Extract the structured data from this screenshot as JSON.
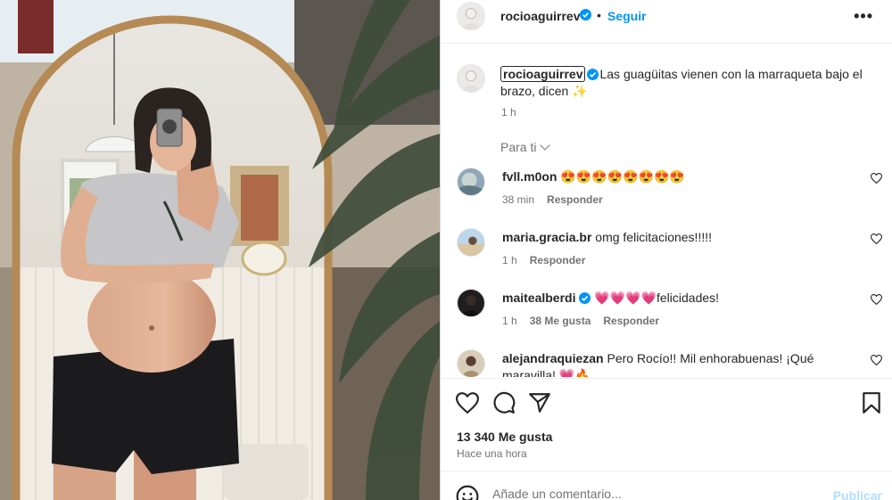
{
  "post": {
    "author": "rocioaguirrev",
    "verified_icon": "verified-badge-icon",
    "separator": "•",
    "follow_label": "Seguir",
    "more_icon": "more-options-icon",
    "more_label": "•••",
    "caption_text": "Las guagüitas vienen con la marraqueta bajo el brazo, dicen",
    "caption_emoji": "✨",
    "caption_time": "1 h",
    "for_you_label": "Para ti"
  },
  "comments": [
    {
      "username": "fvll.m0on",
      "verified": false,
      "text": "😍😍😍😍😍😍😍😍",
      "time": "38 min",
      "likes": "",
      "reply": "Responder"
    },
    {
      "username": "maria.gracia.br",
      "verified": false,
      "text": "omg felicitaciones!!!!!",
      "time": "1 h",
      "likes": "",
      "reply": "Responder"
    },
    {
      "username": "maitealberdi",
      "verified": true,
      "text": "💗💗💗💗felicidades!",
      "time": "1 h",
      "likes": "38 Me gusta",
      "reply": "Responder"
    },
    {
      "username": "alejandraquiezan",
      "verified": false,
      "text": "Pero Rocío!! Mil enhorabuenas! ¡Qué maravilla! 💗🔥",
      "time": "",
      "likes": "",
      "reply": ""
    }
  ],
  "actions": {
    "like_icon": "heart-icon",
    "comment_icon": "comment-icon",
    "share_icon": "share-icon",
    "save_icon": "bookmark-icon",
    "likes_count": "13 340 Me gusta",
    "posted": "Hace una hora"
  },
  "add_comment": {
    "emoji_icon": "emoji-icon",
    "placeholder": "Añade un comentario...",
    "publish_label": "Publicar"
  },
  "colors": {
    "accent": "#0095f6",
    "publish_disabled": "#b2dffc",
    "text": "#262626",
    "muted": "#737373"
  }
}
